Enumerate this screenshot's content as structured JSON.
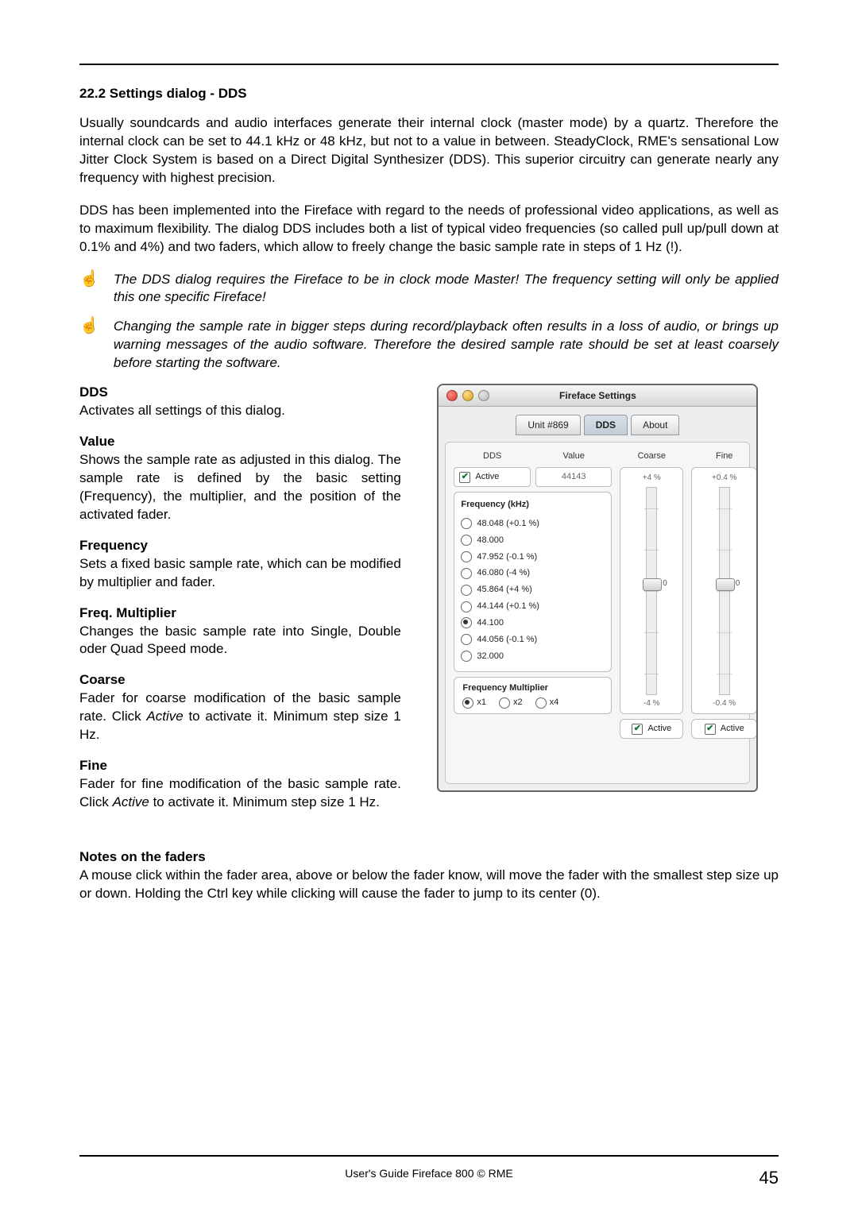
{
  "section_title": "22.2 Settings dialog - DDS",
  "para1": "Usually soundcards and audio interfaces generate their internal clock (master mode) by a quartz. Therefore the internal clock can be set to 44.1 kHz or 48 kHz, but not to a value in between. SteadyClock, RME's sensational Low Jitter Clock System is based on a Direct Digital Synthesizer (DDS). This superior circuitry can generate nearly any frequency with highest precision.",
  "para2": "DDS has been implemented into the Fireface with regard to the needs of professional video applications, as well as to maximum flexibility. The dialog DDS includes both a list of typical video frequencies (so called pull up/pull down at 0.1% and 4%) and two faders, which allow to freely change the basic sample rate in steps of 1 Hz (!).",
  "note1": "The DDS dialog requires the Fireface to be in clock mode Master! The frequency setting will only be applied this one specific Fireface!",
  "note2": "Changing the sample rate in bigger steps during record/playback often results in a loss of audio, or brings up warning messages of the audio software. Therefore the desired sample rate should be set at least coarsely before starting the software.",
  "defs": {
    "dds_t": "DDS",
    "dds_d": "Activates all settings of this dialog.",
    "val_t": "Value",
    "val_d": "Shows the sample rate as adjusted in this dialog. The sample rate is defined by the basic setting (Frequency), the multiplier, and the position of the activated fader.",
    "freq_t": "Frequency",
    "freq_d": "Sets a fixed basic sample rate, which can be modified by multiplier and fader.",
    "mult_t": "Freq. Multiplier",
    "mult_d": "Changes the basic sample rate into Single, Double oder Quad Speed mode.",
    "coarse_t": "Coarse",
    "coarse_d1": "Fader for coarse modification of the basic sample rate. Click ",
    "coarse_active": "Active",
    "coarse_d2": " to activate it. Minimum step size 1 Hz.",
    "fine_t": "Fine",
    "fine_d1": "Fader for fine modification of the basic sample rate. Click ",
    "fine_active": "Active",
    "fine_d2": " to activate it. Minimum step size 1 Hz.",
    "notes_t": "Notes on the faders",
    "notes_d": "A mouse click within the fader area, above or below the fader know, will move the fader with the smallest step size up or down. Holding the Ctrl key while clicking will cause the fader to jump to its center (0)."
  },
  "dialog": {
    "title": "Fireface Settings",
    "tabs": [
      "Unit #869",
      "DDS",
      "About"
    ],
    "active_tab": 1,
    "dds_label": "DDS",
    "value_label": "Value",
    "coarse_label": "Coarse",
    "fine_label": "Fine",
    "active_text": "Active",
    "value": "44143",
    "coarse_top": "+4 %",
    "coarse_mid": "0",
    "coarse_bot": "-4 %",
    "fine_top": "+0.4 %",
    "fine_mid": "0",
    "fine_bot": "-0.4 %",
    "freq_title": "Frequency (kHz)",
    "freqs": [
      {
        "label": "48.048 (+0.1 %)",
        "selected": false
      },
      {
        "label": "48.000",
        "selected": false
      },
      {
        "label": "47.952 (-0.1 %)",
        "selected": false
      },
      {
        "label": "46.080 (-4 %)",
        "selected": false
      },
      {
        "label": "45.864 (+4 %)",
        "selected": false
      },
      {
        "label": "44.144 (+0.1 %)",
        "selected": false
      },
      {
        "label": "44.100",
        "selected": true
      },
      {
        "label": "44.056 (-0.1 %)",
        "selected": false
      },
      {
        "label": "32.000",
        "selected": false
      }
    ],
    "mult_title": "Frequency Multiplier",
    "mults": [
      {
        "label": "x1",
        "selected": true
      },
      {
        "label": "x2",
        "selected": false
      },
      {
        "label": "x4",
        "selected": false
      }
    ]
  },
  "footer": {
    "text": "User's Guide Fireface 800  ©  RME",
    "page": "45"
  }
}
